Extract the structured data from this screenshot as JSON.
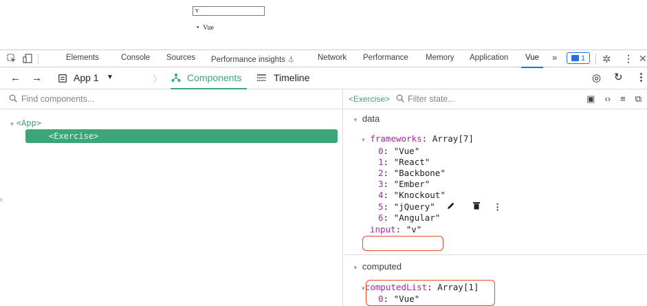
{
  "page": {
    "input_value": "v",
    "list_items": [
      "Vue"
    ]
  },
  "devtools": {
    "tabs": [
      "Elements",
      "Console",
      "Sources",
      "Performance insights",
      "Network",
      "Performance",
      "Memory",
      "Application",
      "Vue"
    ],
    "active_tab": "Vue",
    "more_tabs": "»",
    "issues_count": "1",
    "icons": [
      "inspect-icon",
      "device-toggle-icon",
      "settings-gear-icon",
      "more-vert-icon",
      "close-icon"
    ]
  },
  "vue_toolbar": {
    "app_selector": "App 1",
    "components_label": "Components",
    "timeline_label": "Timeline",
    "accent": "#3ba776"
  },
  "component_tree": {
    "search_placeholder": "Find components...",
    "root": "<App>",
    "selected": "<Exercise>"
  },
  "inspector": {
    "component": "<Exercise>",
    "filter_placeholder": "Filter state...",
    "data_label": "data",
    "frameworks_key": "frameworks",
    "frameworks_type": "Array[7]",
    "frameworks": [
      "\"Vue\"",
      "\"React\"",
      "\"Backbone\"",
      "\"Ember\"",
      "\"Knockout\"",
      "\"jQuery\"",
      "\"Angular\""
    ],
    "input_key": "input",
    "input_value": "\"v\"",
    "computed_label": "computed",
    "computed_key": "computedList",
    "computed_type": "Array[1]",
    "computed_items": [
      "\"Vue\""
    ],
    "highlight_color": "#e8462b"
  }
}
